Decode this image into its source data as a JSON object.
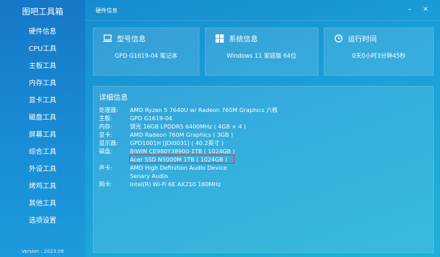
{
  "app": {
    "title": "图吧工具箱",
    "version": "Version : 2023.09"
  },
  "nav": [
    "硬件信息",
    "CPU工具",
    "主板工具",
    "内存工具",
    "显卡工具",
    "磁盘工具",
    "屏幕工具",
    "综合工具",
    "外设工具",
    "烤鸡工具",
    "其他工具",
    "选项设置"
  ],
  "topbar": {
    "title": "硬件信息",
    "minimize": "–",
    "close": "×"
  },
  "cards": {
    "model": {
      "title": "型号信息",
      "value": "GPD G1619-04 笔记本"
    },
    "system": {
      "title": "系统信息",
      "value": "Windows 11 家庭版 64位"
    },
    "uptime": {
      "title": "运行时间",
      "value": "0天0小时3分钟45秒"
    }
  },
  "details": {
    "title": "详细信息",
    "rows": [
      {
        "label": "处理器:",
        "value": "AMD Ryzen 5 7640U w/ Radeon 760M Graphics 六核"
      },
      {
        "label": "主板:",
        "value": "GPD G1619-04"
      },
      {
        "label": "内存:",
        "value": "镁光 16GB LPDDR5 6400MHz ( 4GB × 4 )"
      },
      {
        "label": "显卡:",
        "value": "AMD Radeon 760M Graphics ( 3GB )"
      },
      {
        "label": "显示器:",
        "value": "GPD1001H [JDI0031] ( 40.2英寸 )"
      },
      {
        "label": "磁盘:",
        "value": "BIWIN CE980Y38900-1TB ( 1024GB )"
      },
      {
        "label": "",
        "value": "Acer SSD N5000M 1TB ( 1024GB )"
      },
      {
        "label": "声卡:",
        "value": "AMD High Definition Audio Device"
      },
      {
        "label": "",
        "value": "Senary Audio"
      },
      {
        "label": "网卡:",
        "value": "Intel(R) Wi-Fi 6E AX210 160MHz"
      }
    ]
  },
  "colors": {
    "highlight_border": "#e0352b"
  }
}
